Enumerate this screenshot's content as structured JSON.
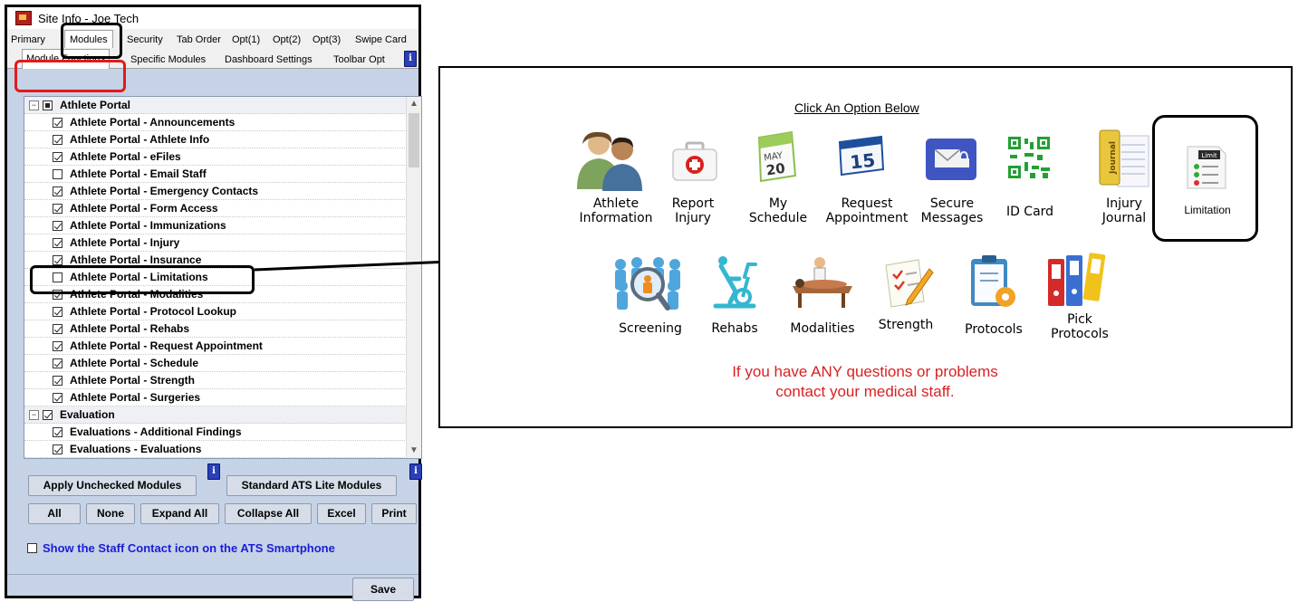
{
  "window": {
    "title": "Site Info - Joe Tech",
    "tabs": [
      "Primary",
      "Modules",
      "Security",
      "Tab Order",
      "Opt(1)",
      "Opt(2)",
      "Opt(3)",
      "Swipe Card"
    ],
    "active_tab": "Modules",
    "subtabs": [
      "Module Functions",
      "Specific Modules",
      "Dashboard Settings",
      "Toolbar Opt"
    ],
    "active_subtab": "Module Functions"
  },
  "tree": {
    "rows": [
      {
        "label": "Athlete Portal",
        "group": true,
        "expander": "−",
        "state": "partial"
      },
      {
        "label": "Athlete Portal - Announcements",
        "state": "checked"
      },
      {
        "label": "Athlete Portal - Athlete Info",
        "state": "checked"
      },
      {
        "label": "Athlete Portal - eFiles",
        "state": "checked"
      },
      {
        "label": "Athlete Portal - Email Staff",
        "state": "unchecked"
      },
      {
        "label": "Athlete Portal - Emergency Contacts",
        "state": "checked"
      },
      {
        "label": "Athlete Portal - Form Access",
        "state": "checked"
      },
      {
        "label": "Athlete Portal - Immunizations",
        "state": "checked"
      },
      {
        "label": "Athlete Portal - Injury",
        "state": "checked"
      },
      {
        "label": "Athlete Portal - Insurance",
        "state": "checked"
      },
      {
        "label": "Athlete Portal - Limitations",
        "state": "unchecked"
      },
      {
        "label": "Athlete Portal - Modalities",
        "state": "checked"
      },
      {
        "label": "Athlete Portal - Protocol Lookup",
        "state": "checked"
      },
      {
        "label": "Athlete Portal - Rehabs",
        "state": "checked"
      },
      {
        "label": "Athlete Portal - Request Appointment",
        "state": "checked"
      },
      {
        "label": "Athlete Portal - Schedule",
        "state": "checked"
      },
      {
        "label": "Athlete Portal - Strength",
        "state": "checked"
      },
      {
        "label": "Athlete Portal - Surgeries",
        "state": "checked"
      },
      {
        "label": "Evaluation",
        "group": true,
        "expander": "−",
        "state": "checked"
      },
      {
        "label": "Evaluations - Additional Findings",
        "state": "checked"
      },
      {
        "label": "Evaluations - Evaluations",
        "state": "checked"
      }
    ]
  },
  "buttons": {
    "apply_unchecked": "Apply Unchecked Modules",
    "standard_ats": "Standard ATS Lite Modules",
    "all": "All",
    "none": "None",
    "expand_all": "Expand All",
    "collapse_all": "Collapse All",
    "excel": "Excel",
    "print": "Print",
    "save": "Save"
  },
  "staff_contact_label": "Show the Staff Contact icon on the ATS Smartphone",
  "portal": {
    "header": "Click An Option Below",
    "options_row1": [
      {
        "label": "Athlete\nInformation",
        "icon": "athlete-people-icon"
      },
      {
        "label": "Report\nInjury",
        "icon": "first-aid-kit-icon"
      },
      {
        "label": "My\nSchedule",
        "icon": "calendar-icon"
      },
      {
        "label": "Request\nAppointment",
        "icon": "calendar-15-icon"
      },
      {
        "label": "Secure\nMessages",
        "icon": "secure-envelope-icon"
      },
      {
        "label": "ID Card",
        "icon": "qr-code-icon"
      },
      {
        "label": "Injury\nJournal",
        "icon": "journal-icon"
      },
      {
        "label": "Limitation",
        "icon": "limit-checklist-icon"
      }
    ],
    "options_row2": [
      {
        "label": "Screening",
        "icon": "screening-magnifier-icon"
      },
      {
        "label": "Rehabs",
        "icon": "exercise-bike-icon"
      },
      {
        "label": "Modalities",
        "icon": "massage-table-icon"
      },
      {
        "label": "Strength",
        "icon": "checklist-pencil-icon"
      },
      {
        "label": "Protocols",
        "icon": "clipboard-gear-icon"
      },
      {
        "label": "Pick\nProtocols",
        "icon": "binders-icon"
      }
    ],
    "calendar_month": "MAY",
    "calendar_day": "20",
    "calendar2_day": "15",
    "journal_spine": "Journal",
    "limit_tag": "Limit",
    "footer_line1": "If you have ANY questions or problems",
    "footer_line2": "contact your medical staff."
  }
}
